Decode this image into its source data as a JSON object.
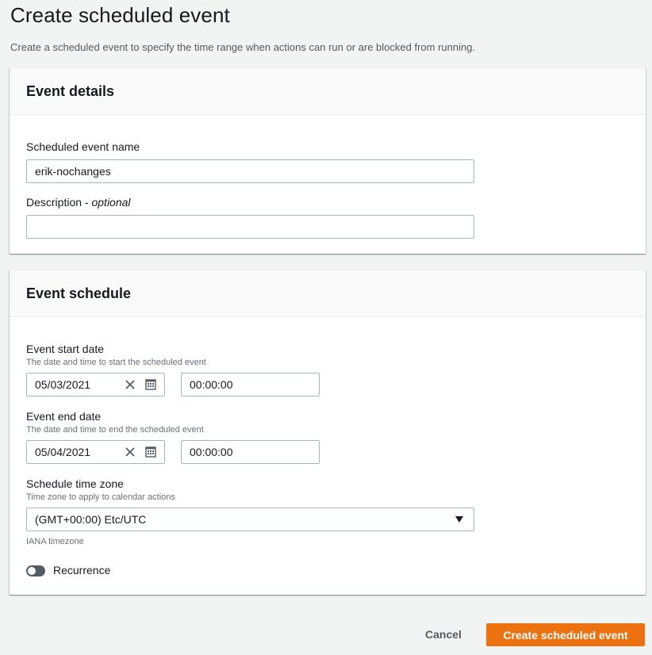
{
  "page": {
    "title": "Create scheduled event",
    "description": "Create a scheduled event to specify the time range when actions can run or are blocked from running."
  },
  "event_details": {
    "header": "Event details",
    "name_label": "Scheduled event name",
    "name_value": "erik-nochanges",
    "description_label": "Description",
    "description_optional": "optional",
    "description_value": ""
  },
  "event_schedule": {
    "header": "Event schedule",
    "start": {
      "label": "Event start date",
      "hint": "The date and time to start the scheduled event",
      "date": "05/03/2021",
      "time": "00:00:00"
    },
    "end": {
      "label": "Event end date",
      "hint": "The date and time to end the scheduled event",
      "date": "05/04/2021",
      "time": "00:00:00"
    },
    "timezone": {
      "label": "Schedule time zone",
      "hint": "Time zone to apply to calendar actions",
      "value": "(GMT+00:00) Etc/UTC",
      "footer": "IANA timezone"
    },
    "recurrence": {
      "label": "Recurrence",
      "enabled": false
    }
  },
  "actions": {
    "cancel": "Cancel",
    "submit": "Create scheduled event"
  },
  "colors": {
    "primary": "#ec7211",
    "background": "#f2f3f3"
  }
}
